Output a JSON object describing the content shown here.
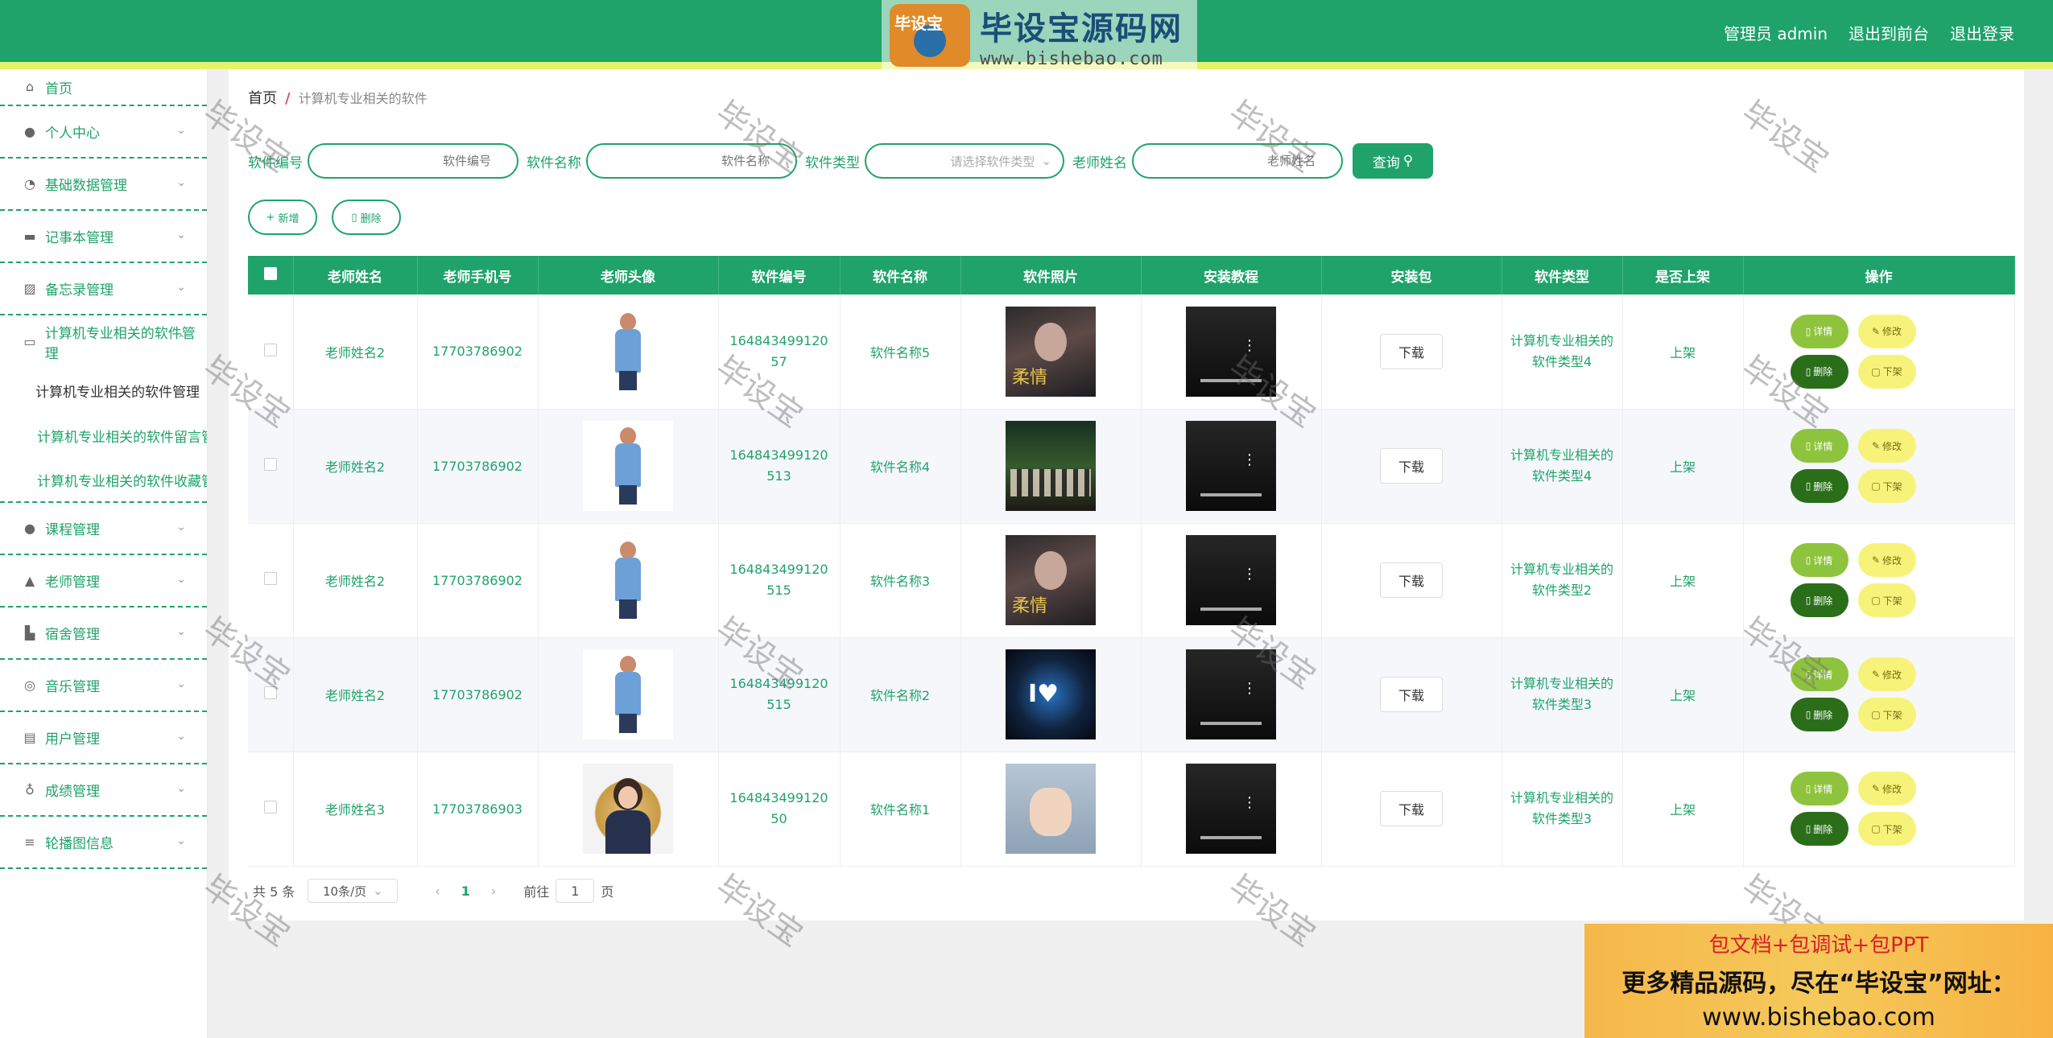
{
  "header": {
    "admin_label": "管理员 admin",
    "to_front": "退出到前台",
    "logout": "退出登录",
    "logo_badge": "毕设宝",
    "logo_cn": "毕设宝源码网",
    "logo_en": "www.bishebao.com"
  },
  "sidebar": {
    "items": [
      {
        "label": "首页",
        "icon": "home-icon"
      },
      {
        "label": "个人中心",
        "icon": "user-icon"
      },
      {
        "label": "基础数据管理",
        "icon": "bell-icon"
      },
      {
        "label": "记事本管理",
        "icon": "monitor-icon"
      },
      {
        "label": "备忘录管理",
        "icon": "chart-icon"
      },
      {
        "label": "计算机专业相关的软件管理",
        "icon": "chat-icon"
      },
      {
        "label": "课程管理",
        "icon": "user-icon"
      },
      {
        "label": "老师管理",
        "icon": "teacher-icon"
      },
      {
        "label": "宿舍管理",
        "icon": "building-icon"
      },
      {
        "label": "音乐管理",
        "icon": "compass-icon"
      },
      {
        "label": "用户管理",
        "icon": "clipboard-icon"
      },
      {
        "label": "成绩管理",
        "icon": "mic-icon"
      },
      {
        "label": "轮播图信息",
        "icon": "sliders-icon"
      }
    ],
    "sub_items": [
      "计算机专业相关的软件管理",
      "计算机专业相关的软件留言管理",
      "计算机专业相关的软件收藏管理"
    ]
  },
  "breadcrumb": {
    "home": "首页",
    "sep": "/",
    "current": "计算机专业相关的软件"
  },
  "search": {
    "f1_label": "软件编号",
    "f1_placeholder": "软件编号",
    "f2_label": "软件名称",
    "f2_placeholder": "软件名称",
    "f3_label": "软件类型",
    "f3_placeholder": "请选择软件类型",
    "f4_label": "老师姓名",
    "f4_placeholder": "老师姓名",
    "query": "查询"
  },
  "actions": {
    "add": "新增",
    "delete": "删除"
  },
  "table": {
    "headers": [
      "老师姓名",
      "老师手机号",
      "老师头像",
      "软件编号",
      "软件名称",
      "软件照片",
      "安装教程",
      "安装包",
      "软件类型",
      "是否上架",
      "操作"
    ],
    "rows": [
      {
        "teacher": "老师姓名2",
        "phone": "17703786902",
        "code": "16484349912057",
        "name": "软件名称5",
        "download": "下载",
        "type": "计算机专业相关的软件类型4",
        "status": "上架",
        "detail": "详情",
        "edit": "修改",
        "del": "删除",
        "off": "下架"
      },
      {
        "teacher": "老师姓名2",
        "phone": "17703786902",
        "code": "164843499120513",
        "name": "软件名称4",
        "download": "下载",
        "type": "计算机专业相关的软件类型4",
        "status": "上架",
        "detail": "详情",
        "edit": "修改",
        "del": "删除",
        "off": "下架"
      },
      {
        "teacher": "老师姓名2",
        "phone": "17703786902",
        "code": "164843499120515",
        "name": "软件名称3",
        "download": "下载",
        "type": "计算机专业相关的软件类型2",
        "status": "上架",
        "detail": "详情",
        "edit": "修改",
        "del": "删除",
        "off": "下架"
      },
      {
        "teacher": "老师姓名2",
        "phone": "17703786902",
        "code": "164843499120515",
        "name": "软件名称2",
        "download": "下载",
        "type": "计算机专业相关的软件类型3",
        "status": "上架",
        "detail": "详情",
        "edit": "修改",
        "del": "删除",
        "off": "下架"
      },
      {
        "teacher": "老师姓名3",
        "phone": "17703786903",
        "code": "16484349912050",
        "name": "软件名称1",
        "download": "下载",
        "type": "计算机专业相关的软件类型3",
        "status": "上架",
        "detail": "详情",
        "edit": "修改",
        "del": "删除",
        "off": "下架"
      }
    ]
  },
  "pager": {
    "total": "共 5 条",
    "size": "10条/页",
    "page": "1",
    "goto_label": "前往",
    "goto_value": "1",
    "page_suffix": "页"
  },
  "watermark": "毕设宝",
  "ad": {
    "line1": "包文档+包调试+包PPT",
    "line2": "更多精品源码，尽在“毕设宝”网址：",
    "line3": "www.bishebao.com"
  },
  "colors": {
    "primary": "#1fa36b",
    "accent_yellow": "#e6f26a",
    "detail_btn": "#8ec43d",
    "edit_btn": "#f7f37a",
    "delete_btn": "#2a6e1a"
  }
}
